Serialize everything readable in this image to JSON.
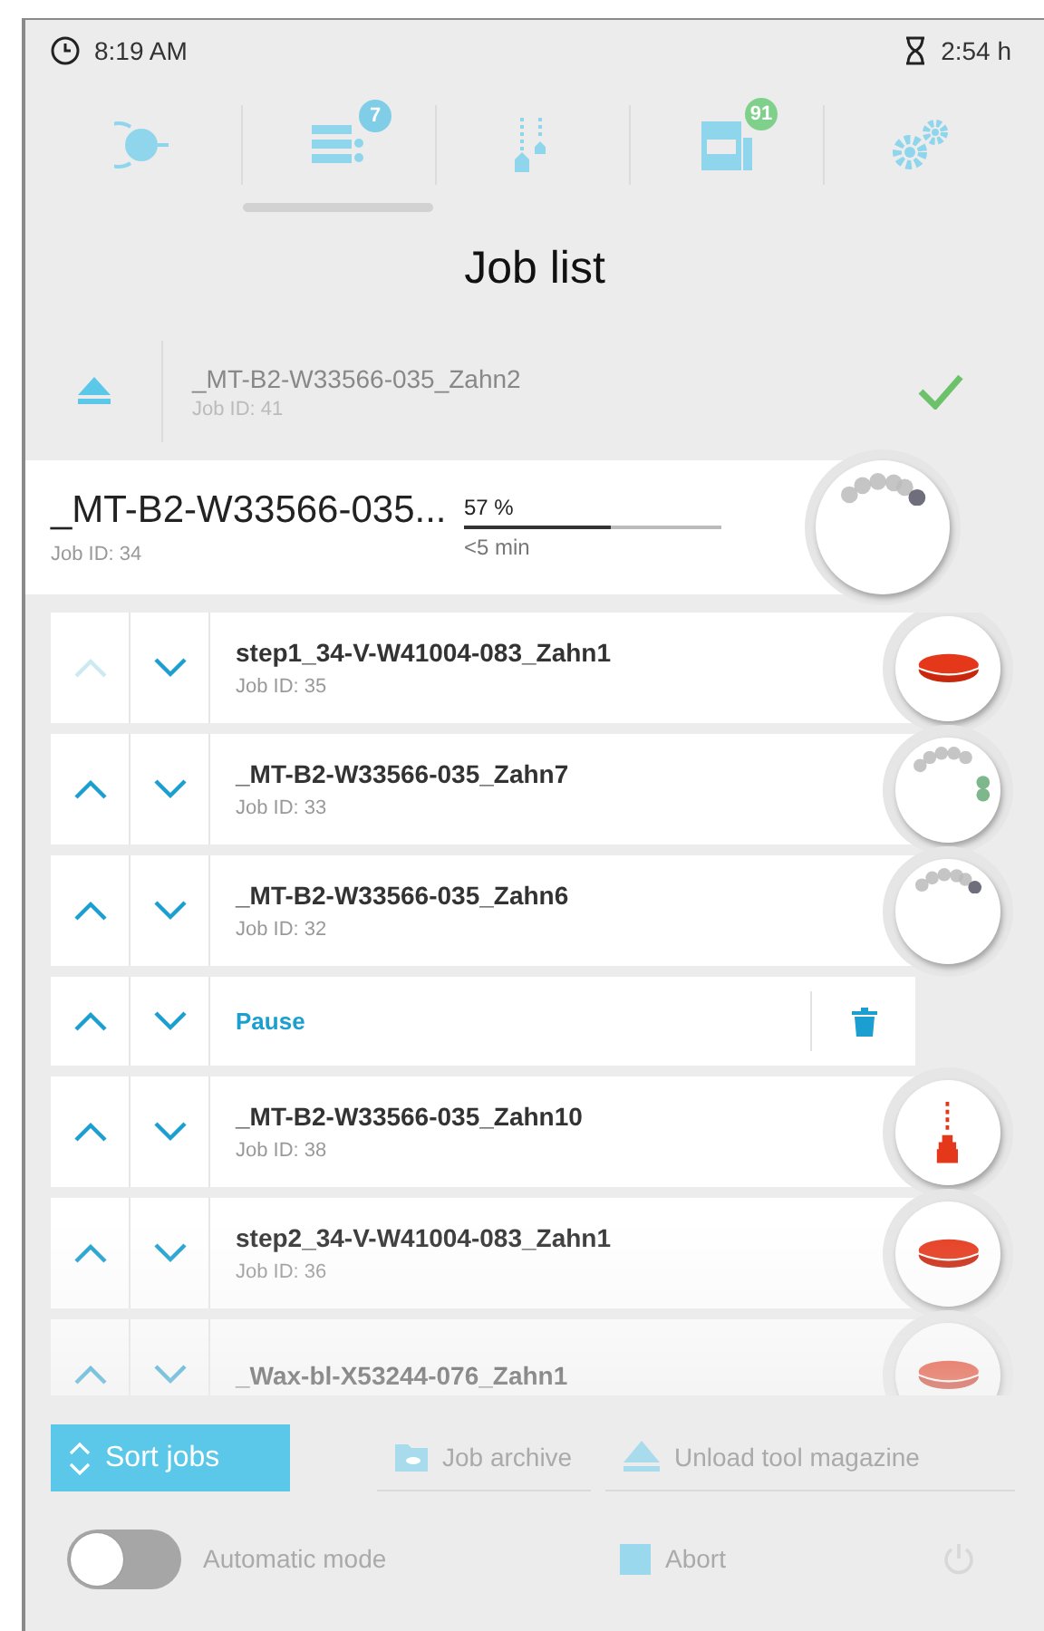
{
  "status_bar": {
    "time": "8:19 AM",
    "remaining": "2:54 h"
  },
  "nav_tabs": [
    {
      "selected": false
    },
    {
      "badge": "7",
      "selected": true
    },
    {
      "selected": false
    },
    {
      "badge": "91",
      "selected": false
    },
    {
      "selected": false
    }
  ],
  "title": "Job list",
  "finished_job": {
    "name": "_MT-B2-W33566-035_Zahn2",
    "job_id": "Job ID: 41",
    "done": true
  },
  "current_job": {
    "name": "_MT-B2-W33566-035...",
    "job_id": "Job ID: 34",
    "percent": "57 %",
    "level": 0.57,
    "remaining": "<5 min"
  },
  "queue": [
    {
      "kind": "job",
      "up_disabled": true,
      "name": "step1_34-V-W41004-083_Zahn1",
      "job_id": "Job ID: 35"
    },
    {
      "kind": "job",
      "up_disabled": false,
      "name": "_MT-B2-W33566-035_Zahn7",
      "job_id": "Job ID: 33"
    },
    {
      "kind": "job",
      "up_disabled": false,
      "name": "_MT-B2-W33566-035_Zahn6",
      "job_id": "Job ID: 32"
    },
    {
      "kind": "pause",
      "up_disabled": false,
      "label": "Pause"
    },
    {
      "kind": "job",
      "up_disabled": false,
      "name": "_MT-B2-W33566-035_Zahn10",
      "job_id": "Job ID: 38"
    },
    {
      "kind": "job",
      "up_disabled": false,
      "name": "step2_34-V-W41004-083_Zahn1",
      "job_id": "Job ID: 36"
    },
    {
      "kind": "job",
      "up_disabled": false,
      "name": "_Wax-bl-X53244-076_Zahn1"
    }
  ],
  "actions": [
    {
      "label": "Sort jobs",
      "primary": true
    },
    {
      "label": "Job archive",
      "primary": false
    },
    {
      "label": "Unload tool magazine",
      "primary": false
    }
  ],
  "automatic_mode": {
    "label": "Automatic mode",
    "on": false
  },
  "abort": {
    "label": "Abort"
  }
}
